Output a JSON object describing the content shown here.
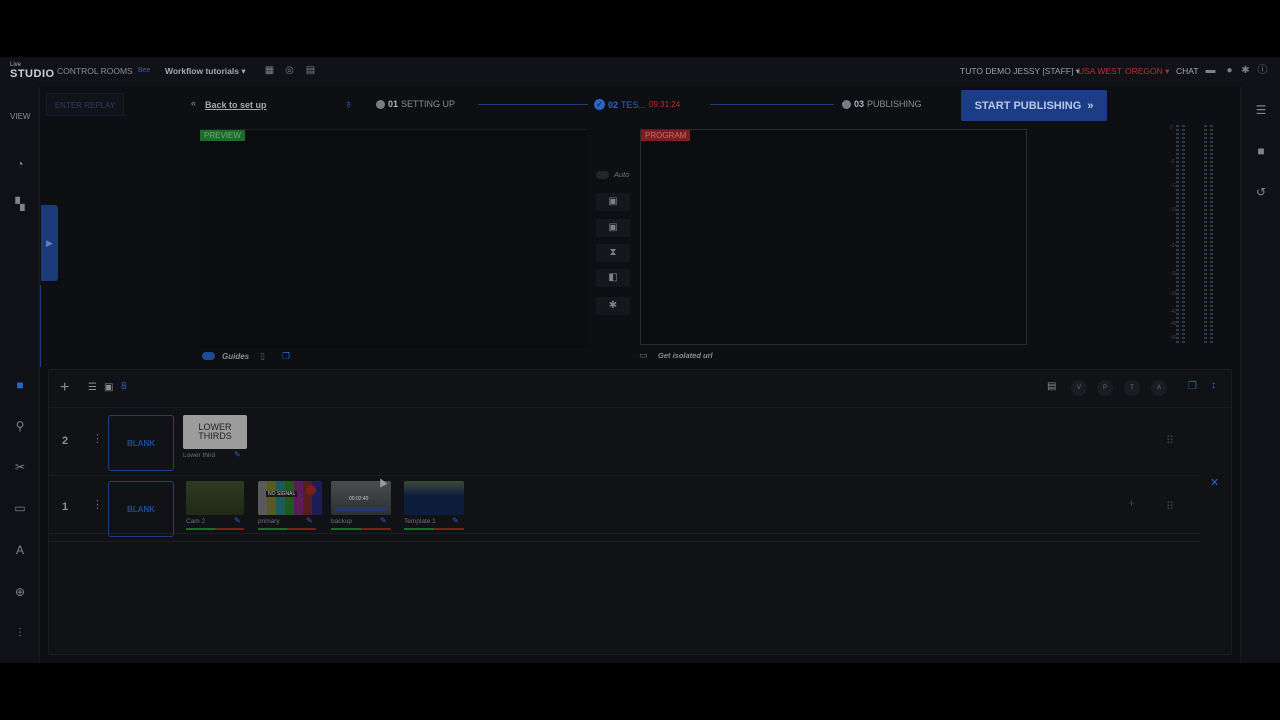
{
  "topbar": {
    "logo_line1": "Live",
    "logo_line2": "STUDIO",
    "control_rooms": "CONTROL ROOMS",
    "org_badge": "Bee",
    "workflow": "Workflow tutorials ▾",
    "account": "TUTO DEMO JESSY [STAFF] ▾",
    "region": "USA WEST",
    "location": "OREGON ▾",
    "chat": "CHAT"
  },
  "left_rail": {
    "view_label": "VIEW"
  },
  "steps": {
    "enter_replay": "ENTER REPLAY",
    "back_label": "Back to set up",
    "step1_num": "01",
    "step1_label": "SETTING UP",
    "step2_num": "02",
    "step2_label": "TES...",
    "timer": "09:31:24",
    "step3_num": "03",
    "step3_label": "PUBLISHING",
    "publish_button": "START PUBLISHING"
  },
  "preview": {
    "tag": "PREVIEW",
    "guides_label": "Guides"
  },
  "program": {
    "tag": "PROGRAM",
    "auto_label": "Auto",
    "isolated_url": "Get isolated url"
  },
  "meter_scale": [
    "0",
    "-6",
    "-12",
    "-18",
    "-24",
    "-30",
    "-36",
    "-42",
    "-48",
    "-60"
  ],
  "timeline": {
    "toolbar_letters": [
      "V",
      "P",
      "T",
      "A"
    ],
    "layers": [
      {
        "number": "2",
        "blank_label": "BLANK",
        "items": [
          {
            "title": "LOWER\nTHIRDS",
            "label": "Lower third"
          }
        ]
      },
      {
        "number": "1",
        "blank_label": "BLANK",
        "items": [
          {
            "label": "Cam 2"
          },
          {
            "label": "primary",
            "overlay": "NO SIGNAL"
          },
          {
            "label": "backup",
            "overlay": "00:02:40"
          },
          {
            "label": "Template 1"
          }
        ]
      }
    ]
  },
  "colors": {
    "accent": "#2a64c8",
    "preview_green": "#1f6a2a",
    "program_red": "#7a1e1e",
    "region_red": "#b0352e"
  }
}
